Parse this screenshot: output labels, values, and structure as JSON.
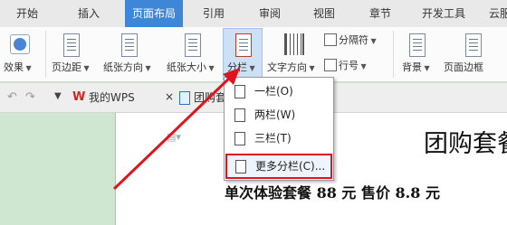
{
  "tabs": [
    "开始",
    "插入",
    "页面布局",
    "引用",
    "审阅",
    "视图",
    "章节",
    "开发工具",
    "云服"
  ],
  "active_tab": "页面布局",
  "ribbon": {
    "effects": "效果",
    "margins": "页边距",
    "orientation": "纸张方向",
    "size": "纸张大小",
    "columns": "分栏",
    "text_direction": "文字方向",
    "separator": "分隔符",
    "line_numbers": "行号",
    "background": "背景",
    "page_border": "页面边框"
  },
  "doc_tabs": {
    "wps_label": "我的WPS",
    "doc_label": "团购套餐"
  },
  "menu": {
    "items": [
      "一栏(O)",
      "两栏(W)",
      "三栏(T)",
      "更多分栏(C)..."
    ]
  },
  "document": {
    "title": "团购套餐",
    "line": "单次体验套餐 88 元  售价 8.8 元"
  },
  "colors": {
    "active_tab": "#3d86d8",
    "highlight_border": "#e0141d",
    "arrow": "#e0141d",
    "doc_background": "#cfe6d0"
  }
}
